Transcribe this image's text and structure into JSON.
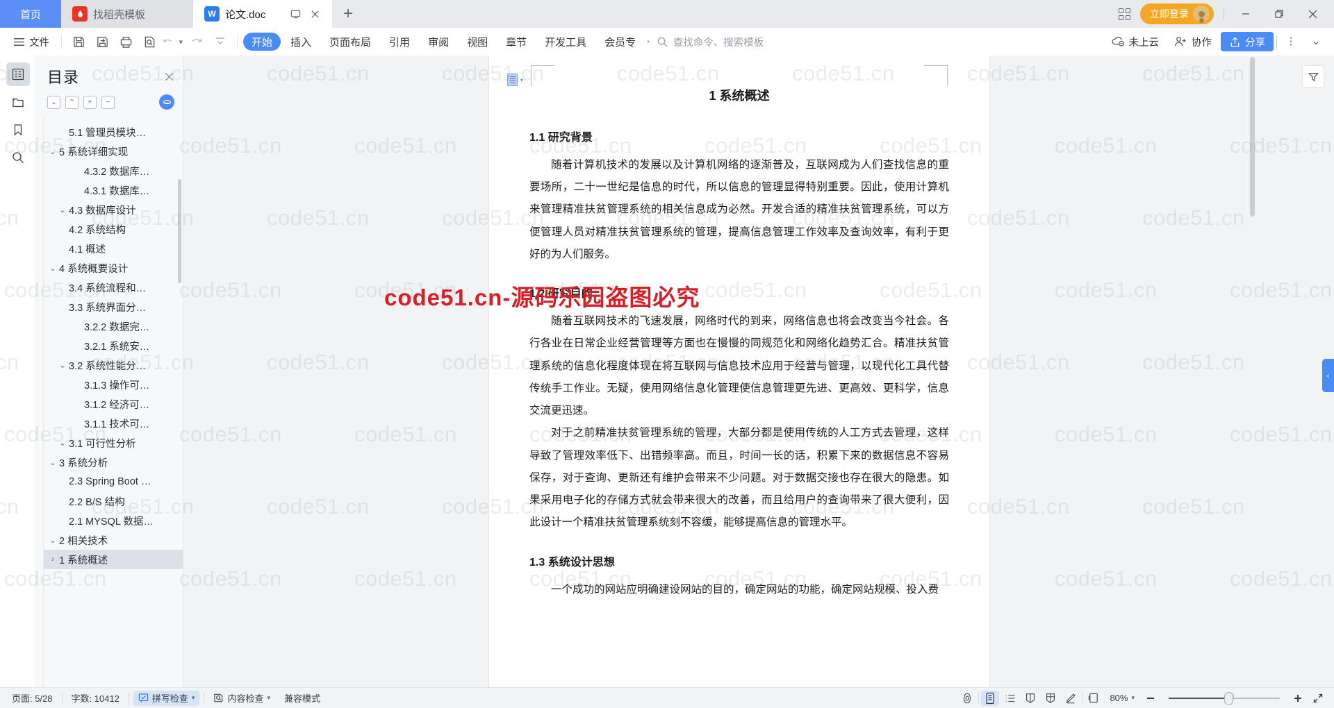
{
  "window": {
    "tabs": [
      {
        "label": "首页",
        "icon": "home",
        "state": "home"
      },
      {
        "label": "找稻壳模板",
        "icon": "daoke-icon",
        "state": "inactive"
      },
      {
        "label": "论文.doc",
        "icon": "word-icon",
        "state": "active"
      }
    ],
    "new_tab_label": "+",
    "apps_icon": "apps-grid-icon",
    "login_label": "立即登录",
    "minimize": "–",
    "maximize": "❐",
    "close": "✕"
  },
  "ribbon": {
    "menu_icon": "hamburger-icon",
    "file_label": "文件",
    "quick_tools": [
      {
        "name": "save-icon"
      },
      {
        "name": "save-as-icon"
      },
      {
        "name": "print-icon"
      },
      {
        "name": "print-preview-icon"
      },
      {
        "name": "undo-icon"
      },
      {
        "name": "redo-icon"
      },
      {
        "name": "customize-icon"
      }
    ],
    "tabs": [
      {
        "label": "开始",
        "active": true
      },
      {
        "label": "插入",
        "active": false
      },
      {
        "label": "页面布局",
        "active": false
      },
      {
        "label": "引用",
        "active": false
      },
      {
        "label": "审阅",
        "active": false
      },
      {
        "label": "视图",
        "active": false
      },
      {
        "label": "章节",
        "active": false
      },
      {
        "label": "开发工具",
        "active": false
      },
      {
        "label": "会员专",
        "active": false
      }
    ],
    "more_tabs_caret": "›",
    "search_placeholder": "查找命令、搜索模板",
    "cloud_status": "未上云",
    "collab_label": "协作",
    "share_label": "分享",
    "more_label": "⋮",
    "collapse_ribbon": "⌄"
  },
  "rail": {
    "items": [
      {
        "name": "outline-icon",
        "active": true
      },
      {
        "name": "document-map-icon",
        "active": false
      },
      {
        "name": "bookmark-icon",
        "active": false
      },
      {
        "name": "search-icon",
        "active": false
      }
    ]
  },
  "toc": {
    "title": "目录",
    "close_label": "✕",
    "tools": [
      {
        "name": "expand-down-button",
        "glyph": "⌄"
      },
      {
        "name": "collapse-up-button",
        "glyph": "⌃"
      },
      {
        "name": "expand-all-button",
        "glyph": "+"
      },
      {
        "name": "collapse-all-button",
        "glyph": "−"
      }
    ],
    "eye_toggle": "eye-icon",
    "items": [
      {
        "label": "1 系统概述",
        "level": 1,
        "caret": "›",
        "selected": true
      },
      {
        "label": "2 相关技术",
        "level": 1,
        "caret": "⌄",
        "selected": false
      },
      {
        "label": "2.1 MYSQL 数据…",
        "level": 2,
        "caret": "",
        "selected": false
      },
      {
        "label": "2.2 B/S 结构",
        "level": 2,
        "caret": "",
        "selected": false
      },
      {
        "label": "2.3 Spring Boot …",
        "level": 2,
        "caret": "",
        "selected": false
      },
      {
        "label": "3 系统分析",
        "level": 1,
        "caret": "⌄",
        "selected": false
      },
      {
        "label": "3.1 可行性分析",
        "level": 2,
        "caret": "⌄",
        "selected": false
      },
      {
        "label": "3.1.1 技术可…",
        "level": 3,
        "caret": "",
        "selected": false
      },
      {
        "label": "3.1.2 经济可…",
        "level": 3,
        "caret": "",
        "selected": false
      },
      {
        "label": "3.1.3 操作可…",
        "level": 3,
        "caret": "",
        "selected": false
      },
      {
        "label": "3.2 系统性能分…",
        "level": 2,
        "caret": "⌄",
        "selected": false
      },
      {
        "label": "3.2.1 系统安…",
        "level": 3,
        "caret": "",
        "selected": false
      },
      {
        "label": "3.2.2 数据完…",
        "level": 3,
        "caret": "",
        "selected": false
      },
      {
        "label": "3.3 系统界面分…",
        "level": 2,
        "caret": "",
        "selected": false
      },
      {
        "label": "3.4 系统流程和…",
        "level": 2,
        "caret": "",
        "selected": false
      },
      {
        "label": "4 系统概要设计",
        "level": 1,
        "caret": "⌄",
        "selected": false
      },
      {
        "label": "4.1 概述",
        "level": 2,
        "caret": "",
        "selected": false
      },
      {
        "label": "4.2 系统结构",
        "level": 2,
        "caret": "",
        "selected": false
      },
      {
        "label": "4.3 数据库设计",
        "level": 2,
        "caret": "⌄",
        "selected": false
      },
      {
        "label": "4.3.1 数据库…",
        "level": 3,
        "caret": "",
        "selected": false
      },
      {
        "label": "4.3.2 数据库…",
        "level": 3,
        "caret": "",
        "selected": false
      },
      {
        "label": "5 系统详细实现",
        "level": 1,
        "caret": "⌄",
        "selected": false
      },
      {
        "label": "5.1 管理员模块…",
        "level": 2,
        "caret": "",
        "selected": false
      }
    ]
  },
  "document": {
    "title": "1 系统概述",
    "sections": [
      {
        "heading": "1.1  研究背景",
        "paragraphs": [
          "随着计算机技术的发展以及计算机网络的逐渐普及，互联网成为人们查找信息的重要场所，二十一世纪是信息的时代，所以信息的管理显得特别重要。因此，使用计算机来管理精准扶贫管理系统的相关信息成为必然。开发合适的精准扶贫管理系统，可以方便管理人员对精准扶贫管理系统的管理，提高信息管理工作效率及查询效率，有利于更好的为人们服务。"
        ]
      },
      {
        "heading": "1.2 研究目的",
        "paragraphs": [
          "随着互联网技术的飞速发展，网络时代的到来，网络信息也将会改变当今社会。各行各业在日常企业经营管理等方面也在慢慢的同规范化和网络化趋势汇合。精准扶贫管理系统的信息化程度体现在将互联网与信息技术应用于经营与管理，以现代化工具代替传统手工作业。无疑，使用网络信息化管理使信息管理更先进、更高效、更科学，信息交流更迅速。",
          "对于之前精准扶贫管理系统的管理，大部分都是使用传统的人工方式去管理，这样导致了管理效率低下、出错频率高。而且，时间一长的话，积累下来的数据信息不容易保存，对于查询、更新还有维护会带来不少问题。对于数据交接也存在很大的隐患。如果采用电子化的存储方式就会带来很大的改善，而且给用户的查询带来了很大便利，因此设计一个精准扶贫管理系统刻不容缓，能够提高信息的管理水平。"
        ]
      },
      {
        "heading": "1.3 系统设计思想",
        "paragraphs": [
          "一个成功的网站应明确建设网站的目的，确定网站的功能，确定网站规模、投入费"
        ]
      }
    ],
    "paragraph_mark_icon": "paragraph-mark-icon"
  },
  "status": {
    "page_label": "页面: 5/28",
    "word_count_label": "字数: 10412",
    "spell_check_label": "拼写检查",
    "content_check_label": "内容检查",
    "compat_mode_label": "兼容模式",
    "view_icons": [
      {
        "name": "focus-mode-icon",
        "active": false
      },
      {
        "name": "print-layout-icon",
        "active": true
      },
      {
        "name": "outline-view-icon",
        "active": false
      },
      {
        "name": "reading-layout-icon",
        "active": false
      },
      {
        "name": "web-layout-icon",
        "active": false
      },
      {
        "name": "annotate-icon",
        "active": false
      }
    ],
    "fit-page-icon": "fit-page-icon",
    "zoom_label": "80%",
    "zoom_out": "−",
    "zoom_in": "+",
    "fullscreen_icon": "fullscreen-icon"
  },
  "watermarks": {
    "text": "code51.cn",
    "red_banner": "code51.cn-源码乐园盗图必究",
    "color": "#d81f26"
  }
}
